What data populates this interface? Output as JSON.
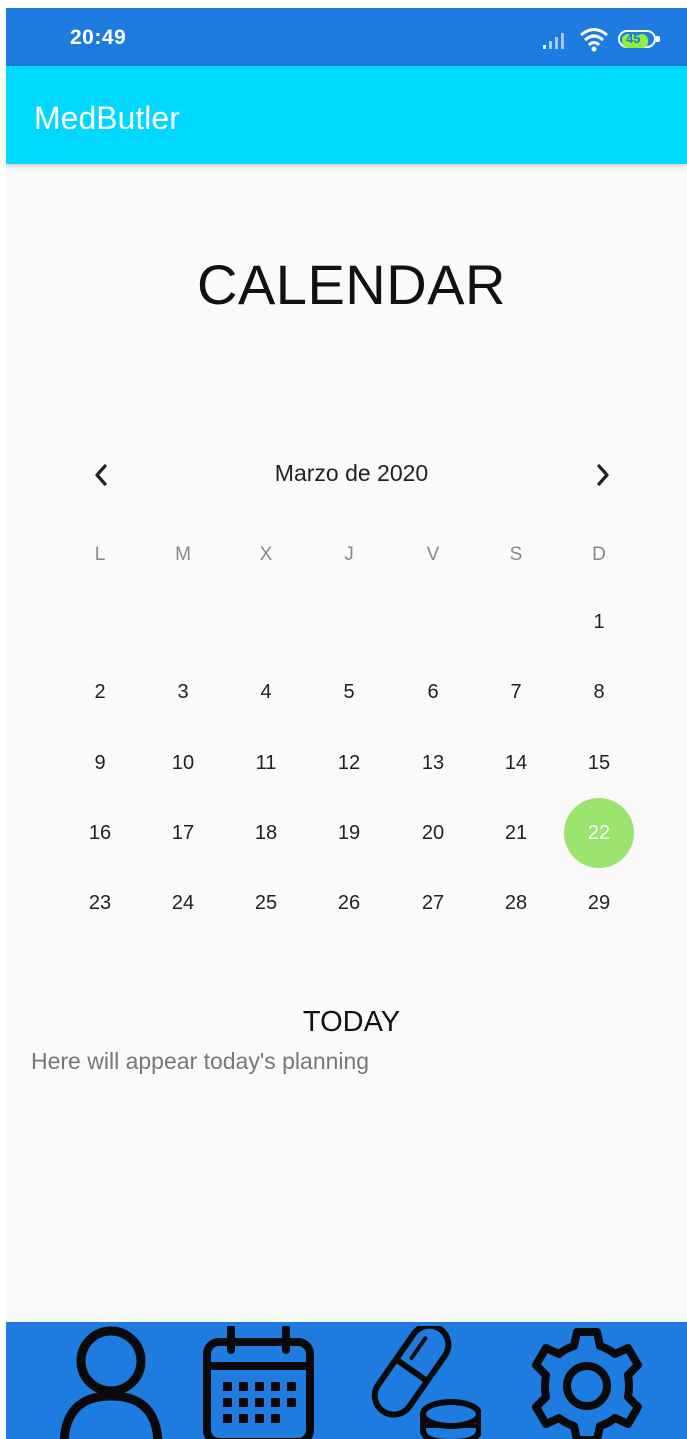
{
  "status_bar": {
    "time": "20:49",
    "battery": "45",
    "icons": [
      "signal-icon",
      "wifi-icon",
      "battery-icon"
    ]
  },
  "app_bar": {
    "title": "MedButler",
    "color": "#00d9ff"
  },
  "page": {
    "title": "CALENDAR"
  },
  "calendar": {
    "month_label": "Marzo de 2020",
    "prev_icon": "chevron-left-icon",
    "next_icon": "chevron-right-icon",
    "weekdays": [
      "L",
      "M",
      "X",
      "J",
      "V",
      "S",
      "D"
    ],
    "weeks": [
      [
        "",
        "",
        "",
        "",
        "",
        "",
        "1"
      ],
      [
        "2",
        "3",
        "4",
        "5",
        "6",
        "7",
        "8"
      ],
      [
        "9",
        "10",
        "11",
        "12",
        "13",
        "14",
        "15"
      ],
      [
        "16",
        "17",
        "18",
        "19",
        "20",
        "21",
        "22"
      ],
      [
        "23",
        "24",
        "25",
        "26",
        "27",
        "28",
        "29"
      ]
    ],
    "selected_day": "22",
    "selected_color": "#9be46e"
  },
  "today": {
    "heading": "TODAY",
    "text": "Here will appear today's planning"
  },
  "bottom_nav": {
    "color": "#1e7be0",
    "items": [
      "profile-icon",
      "calendar-icon",
      "pill-icon",
      "settings-icon"
    ]
  }
}
